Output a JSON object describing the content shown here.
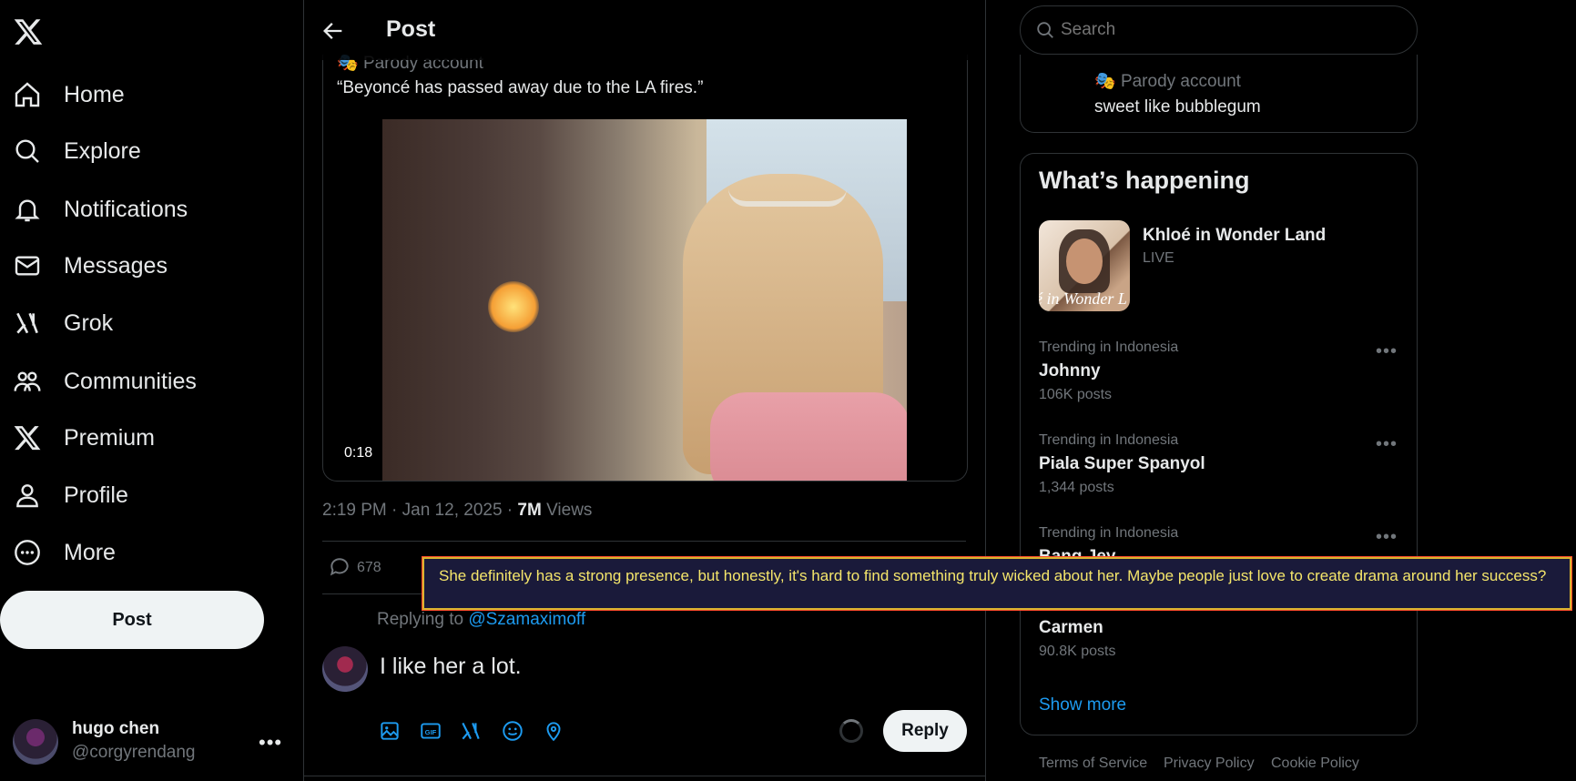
{
  "nav": {
    "items": [
      {
        "label": "Home",
        "icon": "home-icon"
      },
      {
        "label": "Explore",
        "icon": "search-icon"
      },
      {
        "label": "Notifications",
        "icon": "bell-icon"
      },
      {
        "label": "Messages",
        "icon": "mail-icon"
      },
      {
        "label": "Grok",
        "icon": "grok-icon"
      },
      {
        "label": "Communities",
        "icon": "communities-icon"
      },
      {
        "label": "Premium",
        "icon": "x-logo-icon"
      },
      {
        "label": "Profile",
        "icon": "person-icon"
      },
      {
        "label": "More",
        "icon": "more-circle-icon"
      }
    ],
    "post_button": "Post"
  },
  "account": {
    "name": "hugo chen",
    "handle": "@corgyrendang"
  },
  "header": {
    "title": "Post"
  },
  "post": {
    "parody_label": "Parody account",
    "quote": "“Beyoncé has passed away due to the LA fires.”",
    "video_duration": "0:18",
    "time": "2:19 PM · Jan 12, 2025 · ",
    "views_count": "7M",
    "views_label": " Views",
    "reply_count": "678"
  },
  "compose": {
    "replying_prefix": "Replying to ",
    "replying_handle": "@Szamaximoff",
    "text": "I like her a lot.",
    "reply_button": "Reply"
  },
  "search": {
    "placeholder": "Search"
  },
  "sidebar_profile": {
    "parody_label": "Parody account",
    "bio": "sweet like bubblegum"
  },
  "trending": {
    "title": "What’s happening",
    "live": {
      "title": "Khloé in Wonder Land",
      "status": "LIVE",
      "thumb_text": "é in Wonder L"
    },
    "items": [
      {
        "meta": "Trending in Indonesia",
        "name": "Johnny",
        "count": "106K posts"
      },
      {
        "meta": "Trending in Indonesia",
        "name": "Piala Super Spanyol",
        "count": "1,344 posts"
      },
      {
        "meta": "Trending in Indonesia",
        "name": "Bang Jey",
        "count": ""
      },
      {
        "meta": "",
        "name": "Carmen",
        "count": "90.8K posts"
      }
    ],
    "show_more": "Show more"
  },
  "footer": {
    "links": [
      "Terms of Service",
      "Privacy Policy",
      "Cookie Policy"
    ]
  },
  "overlay": {
    "text": "She definitely has a strong presence, but honestly, it's hard to find something truly wicked about her. Maybe people just love to create drama around her success?"
  }
}
